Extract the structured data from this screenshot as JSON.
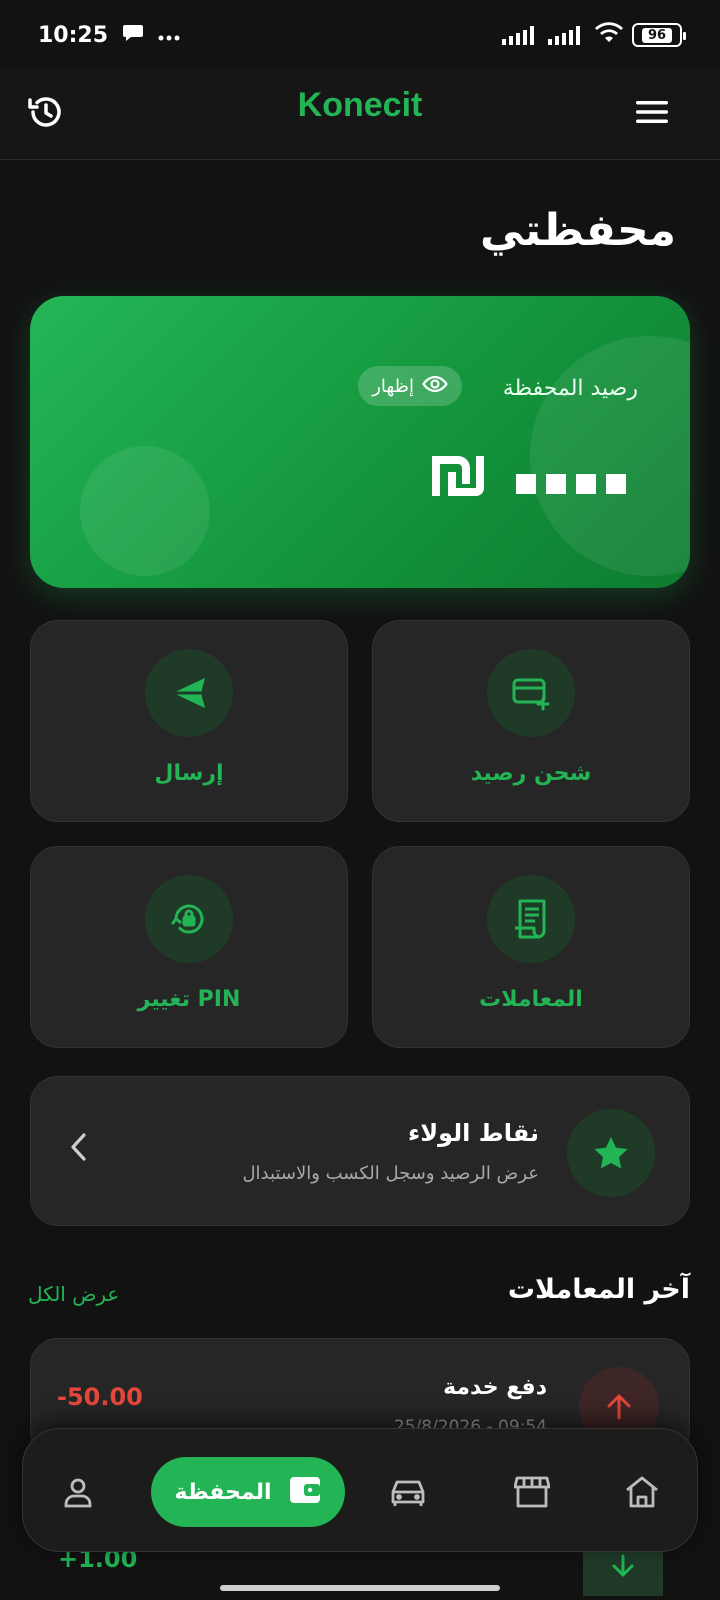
{
  "status_bar": {
    "time": "10:25",
    "battery": "96"
  },
  "header": {
    "title": "Konecit",
    "history_icon": "history-icon",
    "menu_icon": "menu-icon"
  },
  "page_title": "محفظتي",
  "balance_card": {
    "label": "رصيد المحفظة",
    "show_label": "إظهار",
    "masked_value": "••••",
    "currency_icon": "shekel-icon"
  },
  "actions": [
    {
      "label": "إرسال",
      "icon": "send-icon"
    },
    {
      "label": "شحن رصيد",
      "icon": "card-add-icon"
    },
    {
      "label": "تغيير PIN",
      "icon": "lock-reset-icon"
    },
    {
      "label": "المعاملات",
      "icon": "receipt-icon"
    }
  ],
  "loyalty": {
    "title": "نقاط الولاء",
    "subtitle": "عرض الرصيد وسجل الكسب والاستبدال",
    "icon": "star-icon"
  },
  "transactions_section": {
    "title": "آخر المعاملات",
    "view_all": "عرض الكل"
  },
  "transactions": [
    {
      "title": "دفع خدمة",
      "date": "25/8/2026 - 09:54",
      "amount": "-50.00",
      "direction": "out"
    },
    {
      "title": "",
      "date": "",
      "amount": "+1.00",
      "direction": "in"
    }
  ],
  "bottom_nav": {
    "active_label": "المحفظة",
    "items": [
      "profile-icon",
      "wallet-icon",
      "car-icon",
      "store-icon",
      "home-icon"
    ]
  },
  "colors": {
    "accent": "#22b455",
    "background": "#121212",
    "card": "#262626",
    "negative": "#e5483b"
  }
}
